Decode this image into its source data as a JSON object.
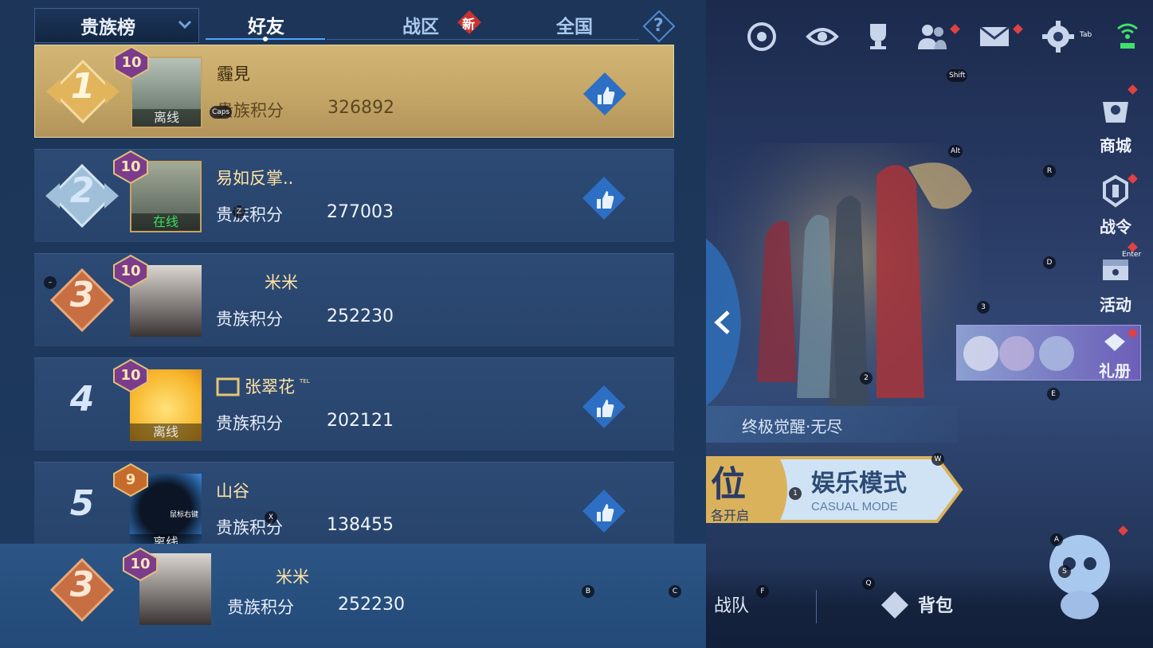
{
  "header": {
    "dropdown_label": "贵族榜",
    "tabs": [
      {
        "label": "好友",
        "active": true
      },
      {
        "label": "战区",
        "active": false
      },
      {
        "label": "全国",
        "active": false
      }
    ],
    "new_badge": "新",
    "help": "?"
  },
  "leaderboard": {
    "score_label": "贵族积分",
    "rows": [
      {
        "rank": "1",
        "vip": "10",
        "name": "霾見",
        "score": "326892",
        "status": "离线",
        "liked": true
      },
      {
        "rank": "2",
        "vip": "10",
        "name": "易如反掌..",
        "score": "277003",
        "status": "在线",
        "liked": true
      },
      {
        "rank": "3",
        "vip": "10",
        "name": "米米",
        "score": "252230",
        "status": "",
        "liked": false
      },
      {
        "rank": "4",
        "vip": "10",
        "name": "张翠花",
        "name_tag": "TEL",
        "score": "202121",
        "status": "离线",
        "liked": true
      },
      {
        "rank": "5",
        "vip": "9",
        "name": "山谷",
        "score": "138455",
        "status": "离线",
        "avatar_overlay": "鼠标右键",
        "liked": true
      }
    ],
    "self_row": {
      "rank": "3",
      "vip": "10",
      "name": "米米",
      "score": "252230"
    }
  },
  "right_panel": {
    "top_icons": [
      "target-icon",
      "eye-icon",
      "trophy-icon",
      "friends-icon",
      "mail-icon",
      "settings-icon",
      "wifi-icon"
    ],
    "side_buttons": [
      {
        "label": "商城",
        "icon": "shop-icon"
      },
      {
        "label": "战令",
        "icon": "battle-pass-icon"
      },
      {
        "label": "活动",
        "icon": "event-icon"
      },
      {
        "label": "礼册",
        "icon": "gift-book-icon"
      }
    ],
    "ticker": "终极觉醒·无尽",
    "mode_left_big": "位",
    "mode_left_small": "各开启",
    "mode_title": "娱乐模式",
    "mode_subtitle": "CASUAL MODE",
    "bottom_items": [
      {
        "label": "战队"
      },
      {
        "label": "背包"
      }
    ]
  },
  "key_hints": {
    "tab": "Tab",
    "shift": "Shift",
    "caps": "Caps",
    "alt": "Alt",
    "r": "R",
    "enter": "Enter",
    "d": "D",
    "three": "3",
    "z": "Z",
    "dash": "–",
    "two": "2",
    "e": "E",
    "w": "W",
    "one": "1",
    "x": "X",
    "a": "A",
    "s": "S",
    "b": "B",
    "c": "C",
    "q": "Q",
    "f": "F"
  },
  "colors": {
    "gold": "#d3b676",
    "panel": "#1e3a60",
    "row": "#2c4a74",
    "accent": "#4aa8ff",
    "red": "#e04141"
  }
}
